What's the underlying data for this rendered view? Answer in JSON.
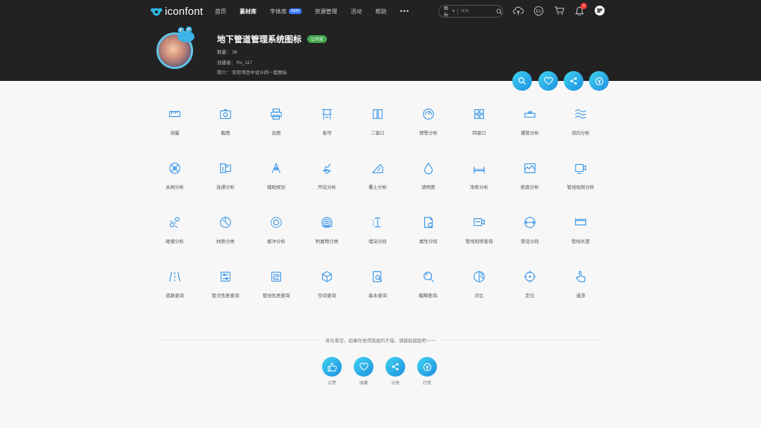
{
  "header": {
    "logo_text": "iconfont",
    "nav": [
      {
        "label": "首页",
        "active": false
      },
      {
        "label": "素材库",
        "active": true
      },
      {
        "label": "字体库",
        "active": false,
        "badge": "NEW"
      },
      {
        "label": "资源管理",
        "active": false
      },
      {
        "label": "活动",
        "active": false
      },
      {
        "label": "帮助",
        "active": false
      }
    ],
    "more": "•••",
    "search": {
      "type": "图标",
      "placeholder": "搜索"
    },
    "notification_count": "3",
    "lang": "En"
  },
  "project": {
    "title": "地下管道管理系统图标",
    "tag": "公开库",
    "count": "数量：  36",
    "creator": "创建者：  Rx_117",
    "intro": "简介：  实际项目中设计的一套图标"
  },
  "icons": [
    {
      "label": "测量",
      "icon": "ruler-icon"
    },
    {
      "label": "截图",
      "icon": "camera-icon"
    },
    {
      "label": "出图",
      "icon": "printer-icon"
    },
    {
      "label": "卷帘",
      "icon": "curtain-icon"
    },
    {
      "label": "二窗口",
      "icon": "two-window-icon"
    },
    {
      "label": "预警分析",
      "icon": "gauge-icon"
    },
    {
      "label": "四窗口",
      "icon": "four-window-icon"
    },
    {
      "label": "爆管分析",
      "icon": "burst-pipe-icon"
    },
    {
      "label": "流向分析",
      "icon": "flow-direction-icon"
    },
    {
      "label": "关阀分析",
      "icon": "valve-icon"
    },
    {
      "label": "连通分析",
      "icon": "connectivity-icon"
    },
    {
      "label": "辅助规划",
      "icon": "compass-icon"
    },
    {
      "label": "开挖分析",
      "icon": "excavation-icon"
    },
    {
      "label": "覆土分析",
      "icon": "soil-cover-icon"
    },
    {
      "label": "透明度",
      "icon": "drop-icon"
    },
    {
      "label": "净距分析",
      "icon": "distance-icon"
    },
    {
      "label": "断面分析",
      "icon": "section-icon"
    },
    {
      "label": "管线视频分析",
      "icon": "video-icon"
    },
    {
      "label": "碰撞分析",
      "icon": "collision-icon"
    },
    {
      "label": "材质分类",
      "icon": "material-icon"
    },
    {
      "label": "缓冲分析",
      "icon": "buffer-icon"
    },
    {
      "label": "附属物分类",
      "icon": "attachment-icon"
    },
    {
      "label": "埋深分段",
      "icon": "depth-icon"
    },
    {
      "label": "属性分段",
      "icon": "attribute-icon"
    },
    {
      "label": "管线视频查询",
      "icon": "video-query-icon"
    },
    {
      "label": "管径分段",
      "icon": "diameter-icon"
    },
    {
      "label": "管线长度",
      "icon": "length-icon"
    },
    {
      "label": "道路查询",
      "icon": "road-icon"
    },
    {
      "label": "管点性质查询",
      "icon": "point-query-icon"
    },
    {
      "label": "管线性质查询",
      "icon": "line-query-icon"
    },
    {
      "label": "空间查询",
      "icon": "cube-icon"
    },
    {
      "label": "基本查询",
      "icon": "basic-search-icon"
    },
    {
      "label": "模糊查询,",
      "icon": "fuzzy-search-icon"
    },
    {
      "label": "对比",
      "icon": "compare-icon"
    },
    {
      "label": "定位",
      "icon": "locate-icon"
    },
    {
      "label": "漫游",
      "icon": "hand-icon"
    }
  ],
  "footer": {
    "message": "各位看官，如果你觉得我画的不错，请鼓励鼓励吧～～",
    "actions": [
      {
        "label": "点赞",
        "icon": "thumbs-up-icon"
      },
      {
        "label": "收藏",
        "icon": "heart-icon"
      },
      {
        "label": "分享",
        "icon": "share-icon"
      },
      {
        "label": "打赏",
        "icon": "reward-icon"
      }
    ]
  },
  "colors": {
    "accent": "#2a8fe8",
    "header_bg": "#222222",
    "tag": "#43a94e"
  }
}
